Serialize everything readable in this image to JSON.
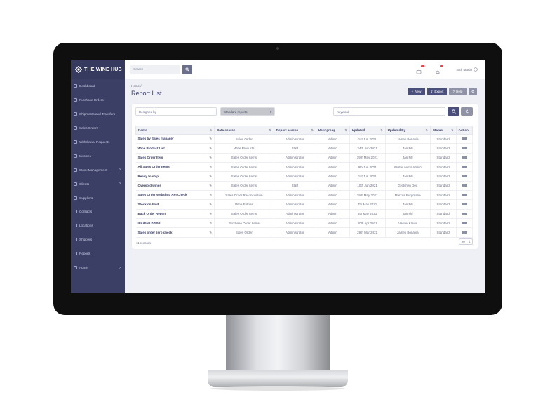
{
  "brand": {
    "name": "THE WINE HUB"
  },
  "sidebar": {
    "items": [
      {
        "label": "Dashboard",
        "icon": "dashboard-icon",
        "chevron": false
      },
      {
        "label": "Purchase Orders",
        "icon": "cart-icon",
        "chevron": false
      },
      {
        "label": "Shipments and Transfers",
        "icon": "truck-icon",
        "chevron": false
      },
      {
        "label": "Sales Orders",
        "icon": "receipt-icon",
        "chevron": false
      },
      {
        "label": "Withdrawal Requests",
        "icon": "withdraw-icon",
        "chevron": false
      },
      {
        "label": "Invoices",
        "icon": "invoice-icon",
        "chevron": false
      },
      {
        "label": "Stock Management",
        "icon": "box-icon",
        "chevron": true
      },
      {
        "label": "Clients",
        "icon": "users-icon",
        "chevron": true
      },
      {
        "label": "Suppliers",
        "icon": "supplier-icon",
        "chevron": false
      },
      {
        "label": "Contacts",
        "icon": "contact-icon",
        "chevron": false
      },
      {
        "label": "Locations",
        "icon": "location-icon",
        "chevron": false
      },
      {
        "label": "Shippers",
        "icon": "shipper-icon",
        "chevron": false
      },
      {
        "label": "Reports",
        "icon": "report-icon",
        "chevron": false
      },
      {
        "label": "Admin",
        "icon": "admin-icon",
        "chevron": true
      }
    ]
  },
  "topbar": {
    "search_placeholder": "Search",
    "user_name": "Nick Martin"
  },
  "breadcrumb": "Home /",
  "page_title": "Report List",
  "toolbar": {
    "new_label": "New",
    "export_label": "Export",
    "help_label": "Help"
  },
  "filters": {
    "designed_by_placeholder": "Designed by",
    "report_type_value": "Standard reports",
    "keyword_placeholder": "Keyword"
  },
  "table": {
    "columns": [
      "Name",
      "Data source",
      "Report access",
      "User group",
      "Updated",
      "Updated By",
      "Status",
      "Action"
    ],
    "rows": [
      [
        "Sales by Sales manager",
        "Sales Order",
        "Administrator",
        "Admin",
        "1st Jun 2021",
        "James Bonavia",
        "Standard"
      ],
      [
        "Wine Product List",
        "Wine Products",
        "Staff",
        "Admin",
        "24th Jun 2021",
        "Jan Fitl",
        "Standard"
      ],
      [
        "Sales Order Item",
        "Sales Order Items",
        "Administrator",
        "Admin",
        "19th May 2021",
        "Jan Fitl",
        "Standard"
      ],
      [
        "All Sales Order Items",
        "Sales Order Items",
        "Administrator",
        "Admin",
        "9th Jun 2021",
        "Wolter demo admin",
        "Standard"
      ],
      [
        "Ready to ship",
        "Sales Order Items",
        "Administrator",
        "Admin",
        "1st Jun 2021",
        "Jan Fitl",
        "Standard"
      ],
      [
        "Oversold wines",
        "Sales Order Items",
        "Staff",
        "Admin",
        "10th Jun 2021",
        "Gretchen Dec",
        "Standard"
      ],
      [
        "Sales Order Webshop API Check",
        "Sales Order Reconciliation",
        "Administrator",
        "Admin",
        "19th May 2021",
        "Markus Burgmann",
        "Standard"
      ],
      [
        "Stock on hold",
        "Wine Entries",
        "Administrator",
        "Admin",
        "7th May 2021",
        "Jan Fitl",
        "Standard"
      ],
      [
        "Back Order Report",
        "Sales Order Items",
        "Administrator",
        "Admin",
        "5th May 2021",
        "Jan Fitl",
        "Standard"
      ],
      [
        "Intrastat Report",
        "Purchase Order Items",
        "Administrator",
        "Admin",
        "20th Apr 2021",
        "Vaclav Kraus",
        "Standard"
      ],
      [
        "Sales order zero check",
        "Sales Order",
        "Administrator",
        "Admin",
        "29th Mar 2021",
        "James Bonavia",
        "Standard"
      ]
    ]
  },
  "footer": {
    "records": "11 records",
    "page_size": "20"
  },
  "colors": {
    "sidebar": "#3b3f66",
    "accent": "#4a4e7a",
    "background": "#eef0f5"
  }
}
